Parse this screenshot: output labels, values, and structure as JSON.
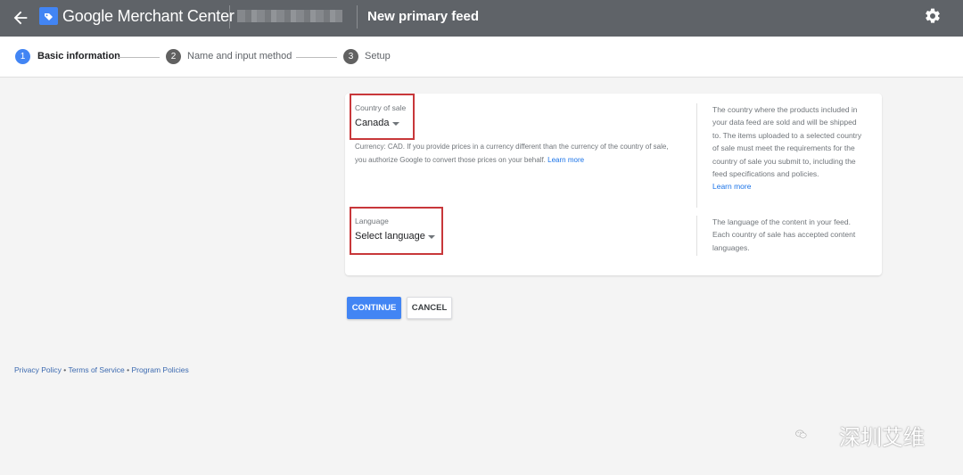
{
  "header": {
    "brand": "Google Merchant Center",
    "page_title": "New primary feed",
    "icons": [
      "arrow-back-icon",
      "merchant-center-logo-icon",
      "gear-icon"
    ]
  },
  "stepper": {
    "steps": [
      {
        "number": "1",
        "label": "Basic information",
        "active": true
      },
      {
        "number": "2",
        "label": "Name and input method",
        "active": false
      },
      {
        "number": "3",
        "label": "Setup",
        "active": false
      }
    ]
  },
  "country": {
    "label": "Country of sale",
    "value": "Canada",
    "help_text": "Currency: CAD. If you provide prices in a currency different than the currency of the country of sale, you authorize Google to convert those prices on your behalf.",
    "help_link": "Learn more",
    "side_text": "The country where the products included in your data feed are sold and will be shipped to. The items uploaded to a selected country of sale must meet the requirements for the country of sale you submit to, including the feed specifications and policies.",
    "side_link": "Learn more"
  },
  "language": {
    "label": "Language",
    "value": "Select language",
    "side_text": "The language of the content in your feed. Each country of sale has accepted content languages."
  },
  "buttons": {
    "continue": "CONTINUE",
    "cancel": "CANCEL"
  },
  "footer": {
    "privacy": "Privacy Policy",
    "sep1": " • ",
    "terms": "Terms of Service",
    "sep2": " • ",
    "program": "Program Policies"
  },
  "watermark": {
    "text": "深圳艾维"
  },
  "colors": {
    "header_bg": "#5f6368",
    "accent": "#4285f4",
    "step_inactive": "#616161",
    "annotation_red": "#c8373a",
    "link": "#1a73e8"
  }
}
